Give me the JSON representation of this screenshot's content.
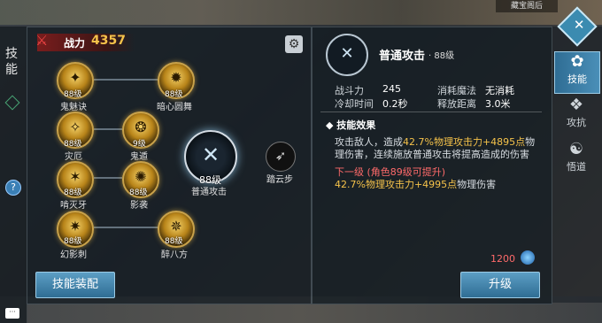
{
  "left_title": "技能",
  "top_right_label": "藏宝阁后",
  "power": {
    "label": "战力",
    "value": "4357"
  },
  "skills": [
    {
      "name": "鬼魅诀",
      "level": "88级"
    },
    {
      "name": "暗心圆舞",
      "level": "88级"
    },
    {
      "name": "灾厄",
      "level": "88级"
    },
    {
      "name": "鬼遁",
      "level": "9级"
    },
    {
      "name": "啃灭牙",
      "level": "88级"
    },
    {
      "name": "影袭",
      "level": "88级"
    },
    {
      "name": "幻影刺",
      "level": "88级"
    },
    {
      "name": "醉八方",
      "level": "88级"
    }
  ],
  "center_skill": {
    "name": "普通攻击",
    "level": "88级"
  },
  "side_skill": {
    "name": "踏云步"
  },
  "buttons": {
    "equip": "技能装配",
    "upgrade": "升级"
  },
  "detail": {
    "name": "普通攻击",
    "level": "· 88级",
    "stats": {
      "power_label": "战斗力",
      "power_value": "245",
      "cost_label": "消耗魔法",
      "cost_value": "无消耗",
      "cooldown_label": "冷却时间",
      "cooldown_value": "0.2秒",
      "range_label": "释放距离",
      "range_value": "3.0米"
    },
    "effect_title": "技能效果",
    "desc_a": "攻击敌人，造成",
    "desc_hl1": "42.7%物理攻击力+4895点",
    "desc_b": "物理伤害，连续施放普通攻击将提高造成的伤害",
    "next_level": "下一级 (角色89级可提升)",
    "next_hl": "42.7%物理攻击力+4995点",
    "next_tail": "物理伤害",
    "upgrade_cost": "1200"
  },
  "tabs": [
    {
      "label": "技能",
      "active": true
    },
    {
      "label": "攻抗",
      "active": false
    },
    {
      "label": "悟道",
      "active": false
    }
  ]
}
